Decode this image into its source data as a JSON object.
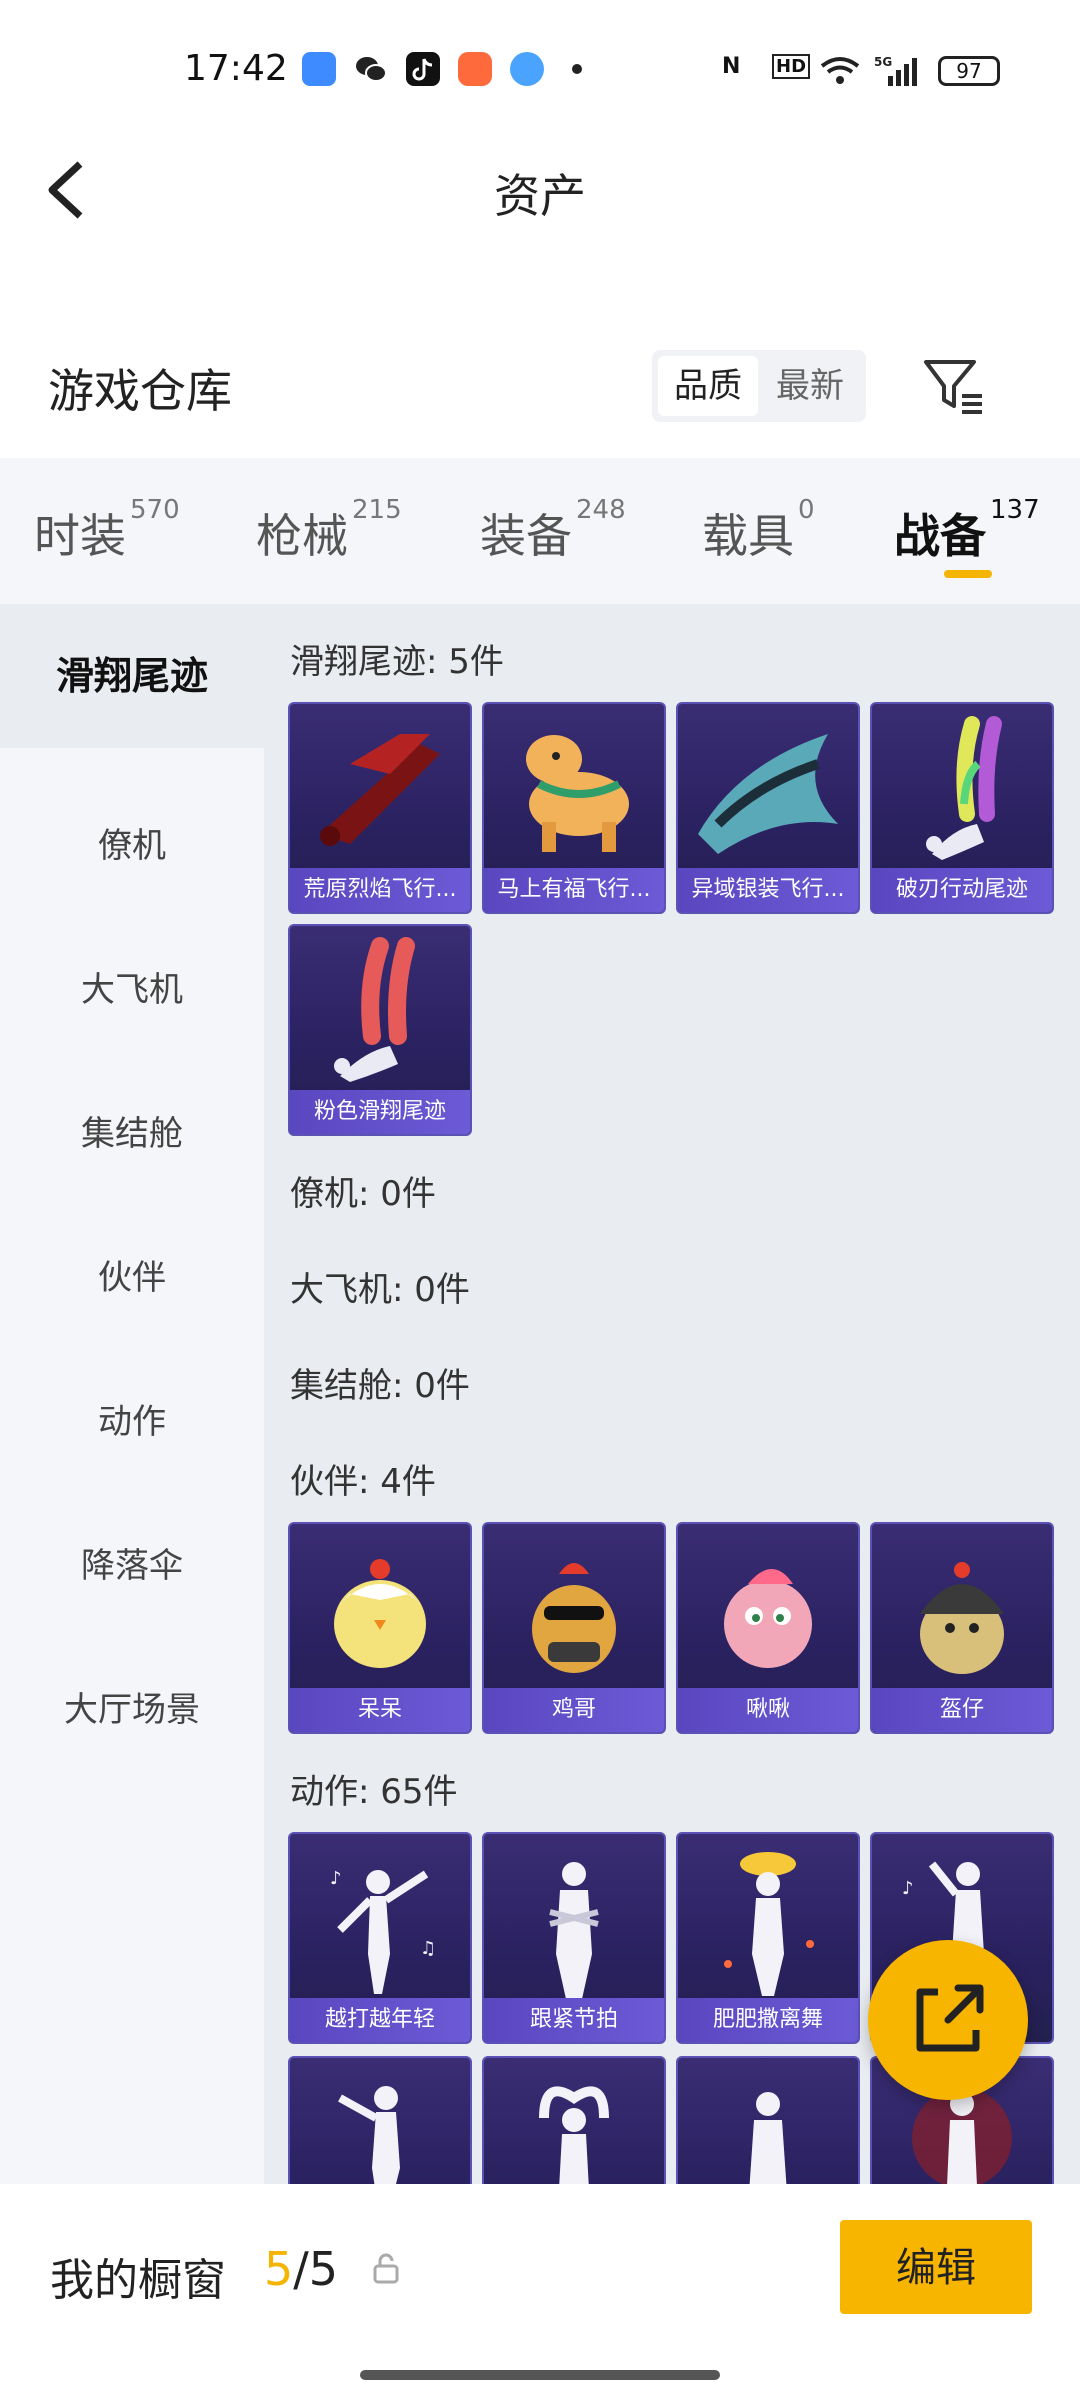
{
  "status_bar": {
    "time": "17:42",
    "battery": "97"
  },
  "header": {
    "title": "资产"
  },
  "warehouse": {
    "title": "游戏仓库",
    "sort_options": [
      "品质",
      "最新"
    ]
  },
  "tabs": [
    {
      "label": "时装",
      "count": "570"
    },
    {
      "label": "枪械",
      "count": "215"
    },
    {
      "label": "装备",
      "count": "248"
    },
    {
      "label": "载具",
      "count": "0"
    },
    {
      "label": "战备",
      "count": "137"
    }
  ],
  "sidebar": [
    "滑翔尾迹",
    "僚机",
    "大飞机",
    "集结舱",
    "伙伴",
    "动作",
    "降落伞",
    "大厅场景"
  ],
  "groups": {
    "glide": {
      "title": "滑翔尾迹: 5件",
      "items": [
        "荒原烈焰飞行...",
        "马上有福飞行...",
        "异域银装飞行...",
        "破刃行动尾迹",
        "粉色滑翔尾迹"
      ]
    },
    "wingman": {
      "title": "僚机: 0件"
    },
    "plane": {
      "title": "大飞机: 0件"
    },
    "pod": {
      "title": "集结舱: 0件"
    },
    "partner": {
      "title": "伙伴: 4件",
      "items": [
        "呆呆",
        "鸡哥",
        "啾啾",
        "盔仔"
      ]
    },
    "emote": {
      "title": "动作: 65件",
      "items": [
        "越打越年轻",
        "跟紧节拍",
        "肥肥撒离舞"
      ]
    }
  },
  "bottom": {
    "showcase_label": "我的橱窗",
    "current": "5",
    "separator": "/",
    "total": "5",
    "edit_label": "编辑"
  },
  "colors": {
    "accent": "#f7b500",
    "card_bg": "#2a2160",
    "card_label": "#6c5ad6"
  }
}
